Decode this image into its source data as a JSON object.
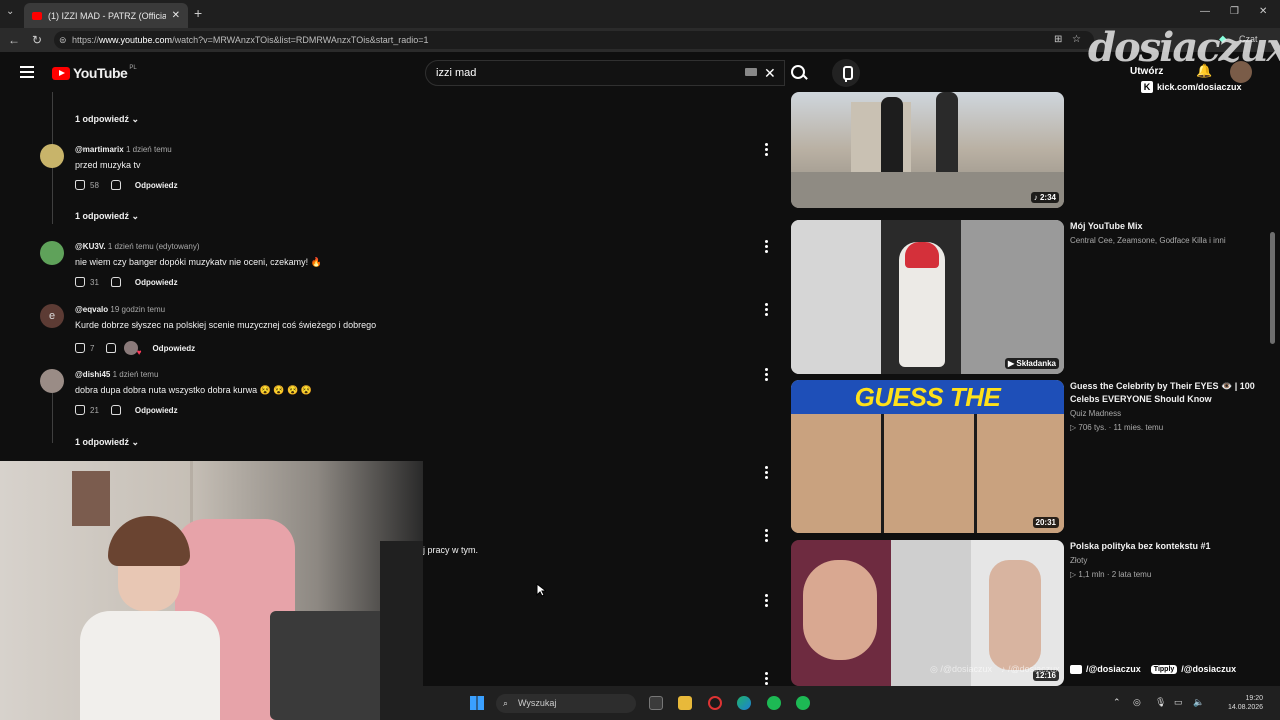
{
  "browser": {
    "tab_title": "(1) IZZI MAD - PATRZ (Official Vide",
    "url_prefix": "https://",
    "url_host": "www.youtube.com",
    "url_path": "/watch?v=MRWAnzxTOis&list=RDMRWAnzxTOis&start_radio=1",
    "chat_label": "Czat"
  },
  "youtube": {
    "logo_text": "YouTube",
    "logo_region": "PL",
    "search_value": "izzi mad",
    "create_label": "Utwórz"
  },
  "overlay": {
    "streamer_logo": "dosiaczux",
    "kick_link": "kick.com/dosiaczux",
    "socials": [
      "/@dosiaczux",
      "/@dosiaczux",
      "/@dosiaczux"
    ],
    "tipply_label": "Tipply",
    "partial_caption": "j pracy w tym."
  },
  "comments": {
    "replies_top": "1 odpowiedź",
    "items": [
      {
        "handle": "@martimarix",
        "time": "1 dzień temu",
        "text": "przed muzyka tv",
        "likes": "58",
        "reply": "Odpowiedz",
        "replies": "1 odpowiedź"
      },
      {
        "handle": "@KU3V.",
        "time": "1 dzień temu (edytowany)",
        "text": "nie wiem czy banger dopóki muzykatv nie oceni, czekamy! 🔥",
        "likes": "31",
        "reply": "Odpowiedz"
      },
      {
        "handle": "@eqvalo",
        "time": "19 godzin temu",
        "text": "Kurde dobrze słyszec na polskiej scenie muzycznej coś świeżego i dobrego",
        "likes": "7",
        "reply": "Odpowiedz",
        "avatar_letter": "e"
      },
      {
        "handle": "@dishi45",
        "time": "1 dzień temu",
        "text": "dobra dupa dobra nuta wszystko dobra kurwa 😵 😵 😵 😵",
        "likes": "21",
        "reply": "Odpowiedz",
        "replies": "1 odpowiedź"
      }
    ]
  },
  "sidebar": {
    "videos": [
      {
        "duration": "2:34"
      },
      {
        "title": "Mój YouTube Mix",
        "channel": "Central Cee, Zeamsone, Godface Killa i inni",
        "badge": "Składanka"
      },
      {
        "thumb_text": "GUESS THE CELEBRITY",
        "title": "Guess the Celebrity by Their EYES 👁️ | 100 Celebs EVERYONE Should Know",
        "channel": "Quiz Madness",
        "views": "706 tys.",
        "age": "11 mies. temu",
        "duration": "20:31"
      },
      {
        "title": "Polska polityka bez kontekstu  #1",
        "channel": "Złoty",
        "views": "1,1 mln",
        "age": "2 lata temu",
        "duration": "12:16"
      }
    ]
  },
  "taskbar": {
    "search_placeholder": "Wyszukaj",
    "time": "19:20",
    "date": "14.08.2026"
  }
}
